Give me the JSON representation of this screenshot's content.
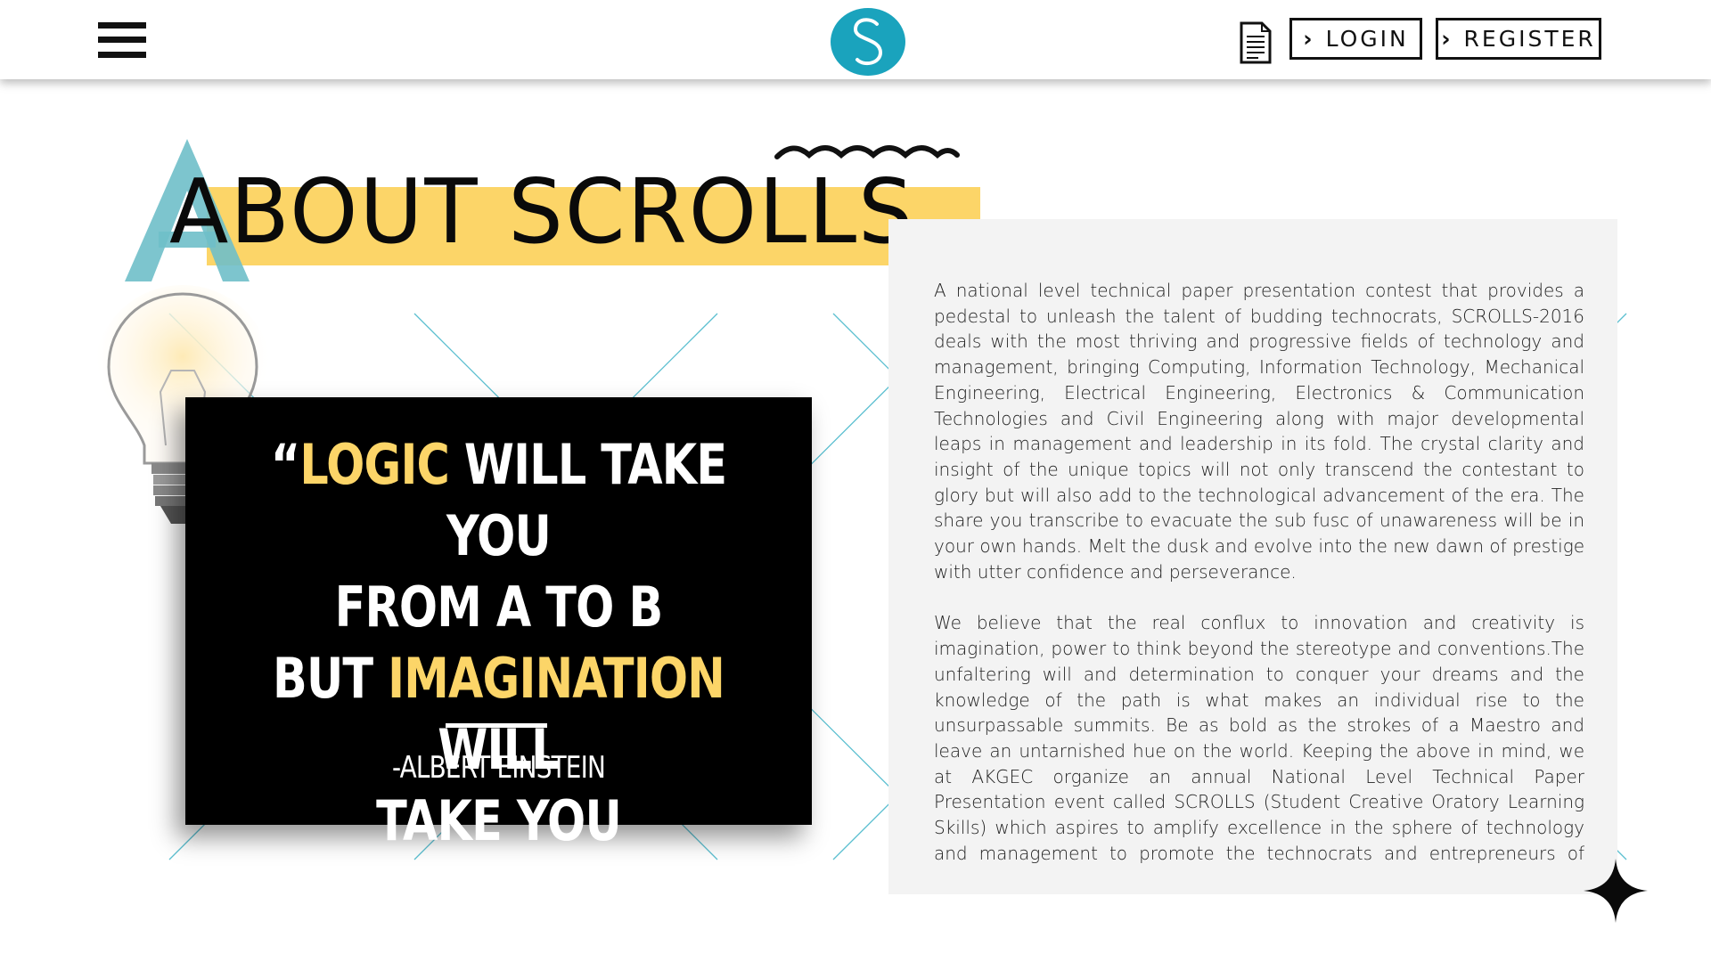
{
  "header": {
    "menu_icon": "hamburger-menu-icon",
    "logo_icon": "scrolls-s-logo-icon",
    "logo_color": "#1aa3bd",
    "doc_icon": "document-icon",
    "login_label": "LOGIN",
    "register_label": "REGISTER",
    "chevron": "›"
  },
  "title": {
    "big_letter": "A",
    "text": "BOUT SCROLLS",
    "highlight_color": "#fcd568",
    "big_letter_color": "#6fbfc9"
  },
  "quote": {
    "open_mark": "“",
    "w1": "LOGIC",
    "p1": " WILL TAKE YOU",
    "line2": "FROM A TO B",
    "p3a": "BUT ",
    "w2": "IMAGINATION",
    "p3b": " WILL",
    "line4": "TAKE YOU ANYWHERE",
    "close_mark": "”",
    "author": "-ALBERT EINSTEIN",
    "accent_color": "#fcd568"
  },
  "about": {
    "paragraphs": [
      "A national level technical paper presentation contest that provides a pedestal to unleash the talent of budding technocrats, SCROLLS-2016 deals with the most thriving and progressive fields of technology and management, bringing Computing, Information Technology, Mechanical Engineering, Electrical Engineering, Electronics & Communication Technologies and Civil Engineering along with major developmental leaps in management and leadership in its fold. The crystal clarity and insight of the unique topics will not only transcend the contestant to glory but will also add to the technological advancement of the era. The share you transcribe to evacuate the sub fusc of unawareness will be in your own hands. Melt the dusk and evolve into the new dawn of prestige with utter confidence and perseverance.",
      "We believe that the real conflux to innovation and creativity is imagination, power to think beyond the stereotype and conventions.The unfaltering will and determination to conquer your dreams and the knowledge of the path is what makes an individual rise to the unsurpassable summits. Be as bold as the strokes of a Maestro and leave an untarnished hue on the world. Keeping the above in mind, we at AKGEC organize an annual National Level Technical Paper Presentation event called SCROLLS (Student Creative Oratory Learning Skills) which aspires to amplify excellence in the sphere of technology and management to promote the technocrats and entrepreneurs of tomorrow. This event provides a prominent rostrum to the evolving professionals who can channelize their talent into creativity and give their"
    ]
  },
  "decor": {
    "bulb_icon": "light-bulb-icon",
    "plus_icon": "plus-icon",
    "pattern_color": "#5bbfd0"
  }
}
